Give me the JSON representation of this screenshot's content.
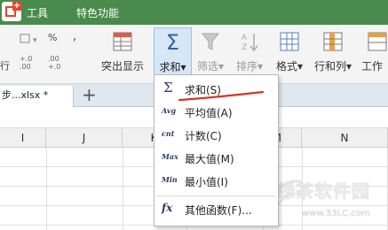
{
  "menubar": {
    "items": [
      "工具",
      "特色功能"
    ]
  },
  "ribbon": {
    "small_percent": "%",
    "small_comma": ",",
    "small_dec_inc": "+.0\n.00",
    "small_dec_dec": ".00\n+.0",
    "small_left_char": "行",
    "buttons": {
      "conditional_format": "突出显示",
      "sum": "求和",
      "filter": "筛选",
      "sort": "排序",
      "format": "格式",
      "rows_cols": "行和列",
      "worksheet": "工作"
    },
    "dropdown_arrow": "▾"
  },
  "tabs": {
    "file_tab": "步...xlsx *",
    "add": "+"
  },
  "sheet": {
    "columns": [
      "I",
      "J",
      "K",
      "L",
      "M",
      "N"
    ]
  },
  "sum_menu": {
    "items": [
      {
        "icon": "Σ",
        "label": "求和(S)"
      },
      {
        "icon": "Avg",
        "label": "平均值(A)"
      },
      {
        "icon": "cnt",
        "label": "计数(C)"
      },
      {
        "icon": "Max",
        "label": "最大值(M)"
      },
      {
        "icon": "Min",
        "label": "最小值(I)"
      },
      {
        "icon": "fx",
        "label": "其他函数(F)..."
      }
    ]
  },
  "watermark": {
    "title": "绿茶软件园",
    "url": "www.33LC.com"
  },
  "colors": {
    "menubar_bg": "#4a8a4c",
    "ribbon_bg": "#f4f4f4",
    "sum_highlight": "#d7e7f7",
    "annotation_red": "#d6322a"
  }
}
